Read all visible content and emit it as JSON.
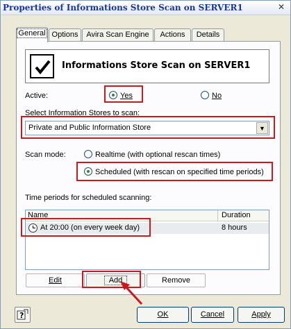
{
  "window": {
    "title": "Properties of Informations Store Scan on SERVER1",
    "close_glyph": "✕"
  },
  "tabs": [
    {
      "label": "General",
      "active": true
    },
    {
      "label": "Options"
    },
    {
      "label": "Avira Scan Engine"
    },
    {
      "label": "Actions"
    },
    {
      "label": "Details"
    }
  ],
  "header": {
    "title": "Informations Store Scan on SERVER1",
    "checked": true
  },
  "active": {
    "label": "Active:",
    "yes_label": "Yes",
    "no_label": "No",
    "selected": "Yes"
  },
  "stores": {
    "label": "Select Information Stores to scan:",
    "value": "Private and Public Information Store"
  },
  "scan_mode": {
    "label": "Scan mode:",
    "realtime_label": "Realtime (with optional rescan times)",
    "scheduled_label": "Scheduled (with rescan on specified time periods)",
    "selected": "Scheduled"
  },
  "time_periods": {
    "label": "Time periods for scheduled scanning:",
    "columns": [
      "Name",
      "Duration"
    ],
    "rows": [
      {
        "name": "At 20:00 (on every week day)",
        "duration": "8 hours"
      }
    ]
  },
  "list_buttons": {
    "edit": "Edit",
    "add": "Add",
    "remove": "Remove"
  },
  "footer": {
    "ok": "OK",
    "cancel": "Cancel",
    "apply": "Apply",
    "help_icon": "help-icon"
  },
  "colors": {
    "highlight_box": "#c8191f",
    "title_text": "#17369b"
  }
}
